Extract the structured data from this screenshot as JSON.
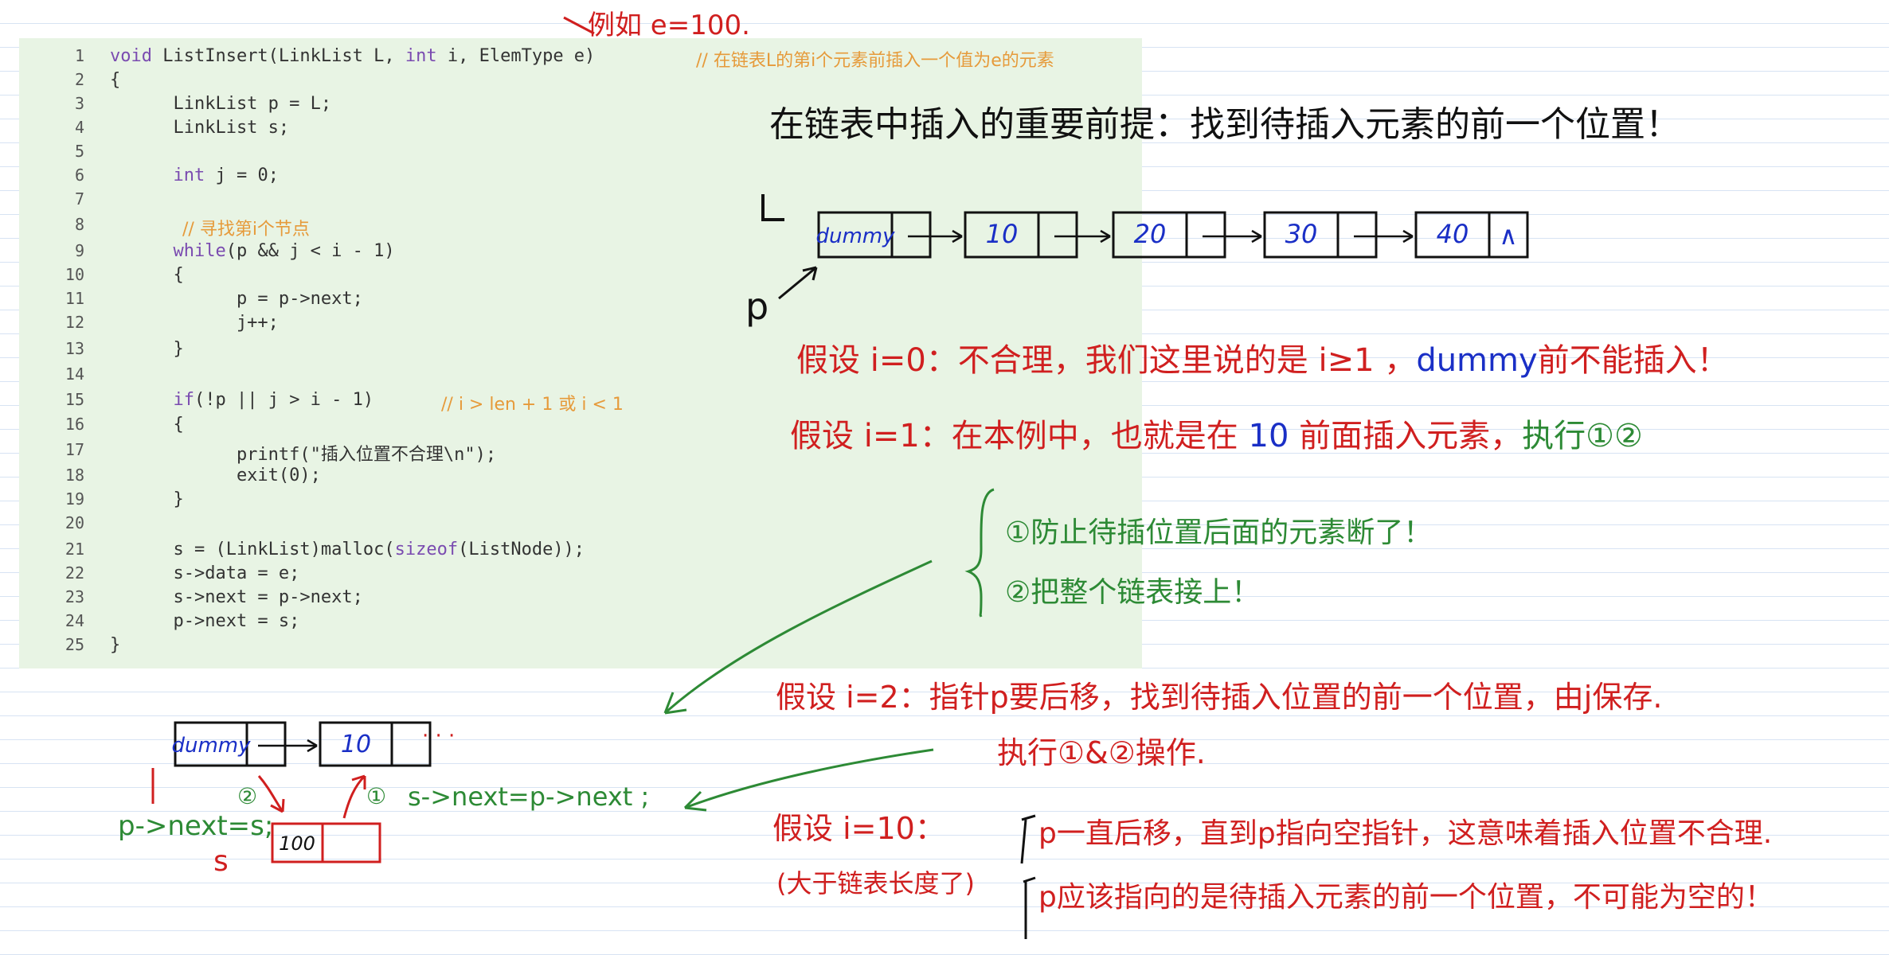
{
  "code": [
    {
      "n": "1",
      "text": "void ListInsert(LinkList L, int i, ElemType e)",
      "comment": "// 在链表L的第i个元素前插入一个值为e的元素"
    },
    {
      "n": "2",
      "text": "{",
      "comment": ""
    },
    {
      "n": "3",
      "text": "      LinkList p = L;",
      "comment": ""
    },
    {
      "n": "4",
      "text": "      LinkList s;",
      "comment": ""
    },
    {
      "n": "5",
      "text": "",
      "comment": ""
    },
    {
      "n": "6",
      "text": "      int j = 0;",
      "comment": ""
    },
    {
      "n": "7",
      "text": "",
      "comment": ""
    },
    {
      "n": "8",
      "text": "      ",
      "comment": "// 寻找第i个节点"
    },
    {
      "n": "9",
      "text": "      while(p && j < i - 1)",
      "comment": ""
    },
    {
      "n": "10",
      "text": "      {",
      "comment": ""
    },
    {
      "n": "11",
      "text": "            p = p->next;",
      "comment": ""
    },
    {
      "n": "12",
      "text": "            j++;",
      "comment": ""
    },
    {
      "n": "13",
      "text": "      }",
      "comment": ""
    },
    {
      "n": "14",
      "text": "",
      "comment": ""
    },
    {
      "n": "15",
      "text": "      if(!p || j > i - 1)",
      "comment": "// i > len + 1 或 i < 1"
    },
    {
      "n": "16",
      "text": "      {",
      "comment": ""
    },
    {
      "n": "17",
      "text": "            printf(\"插入位置不合理\\n\");",
      "comment": ""
    },
    {
      "n": "18",
      "text": "            exit(0);",
      "comment": ""
    },
    {
      "n": "19",
      "text": "      }",
      "comment": ""
    },
    {
      "n": "20",
      "text": "",
      "comment": ""
    },
    {
      "n": "21",
      "text": "      s = (LinkList)malloc(sizeof(ListNode));",
      "comment": ""
    },
    {
      "n": "22",
      "text": "      s->data = e;",
      "comment": ""
    },
    {
      "n": "23",
      "text": "      s->next = p->next;",
      "comment": ""
    },
    {
      "n": "24",
      "text": "      p->next = s;",
      "comment": ""
    },
    {
      "n": "25",
      "text": "}",
      "comment": ""
    }
  ],
  "notes": {
    "top_example": "例如 e=100.",
    "premise": "在链表中插入的重要前提：找到待插入元素的前一个位置！",
    "label_L": "L",
    "label_p": "p",
    "case0_prefix": "假设 i=0：不合理，我们这里说的是 i≥1 ，",
    "case0_dummy": "dummy",
    "case0_suffix": "前不能插入！",
    "case1_prefix": "假设 i=1：在本例中，也就是在",
    "case1_ten": "10",
    "case1_mid": "前面插入元素，",
    "case1_exec": "执行①②",
    "step1": "①防止待插位置后面的元素断了！",
    "step2": "②把整个链表接上！",
    "case2_line1": "假设 i=2：指针p要后移，找到待插入位置的前一个位置，由j保存.",
    "case2_line2": "执行①&②操作.",
    "case10_title": "假设 i=10：",
    "case10_sub": "(大于链表长度了)",
    "case10_line1": "p一直后移，直到p指向空指针，这意味着插入位置不合理.",
    "case10_line2": "p应该指向的是待插入元素的前一个位置，不可能为空的！",
    "bottom_p": "p",
    "bottom_pnext": "p->next=s;",
    "bottom_s": "s",
    "bottom_circle2": "②",
    "bottom_circle1": "①",
    "bottom_snext": "s->next=p->next ;",
    "bottom_dots": "· · ·"
  },
  "top_list": {
    "nodes": [
      "dummy",
      "10",
      "20",
      "30",
      "40"
    ],
    "tail": "∧"
  },
  "bottom_list": {
    "nodes": [
      "dummy",
      "10"
    ],
    "new_node": "100"
  },
  "colors": {
    "code_bg": "#e8f4e4",
    "keyword": "#7a4bb0",
    "comment": "#e69a3a",
    "red_ink": "#d01f1f",
    "green_ink": "#2d8a35",
    "blue_ink": "#1a2fc6",
    "black_ink": "#111111"
  }
}
